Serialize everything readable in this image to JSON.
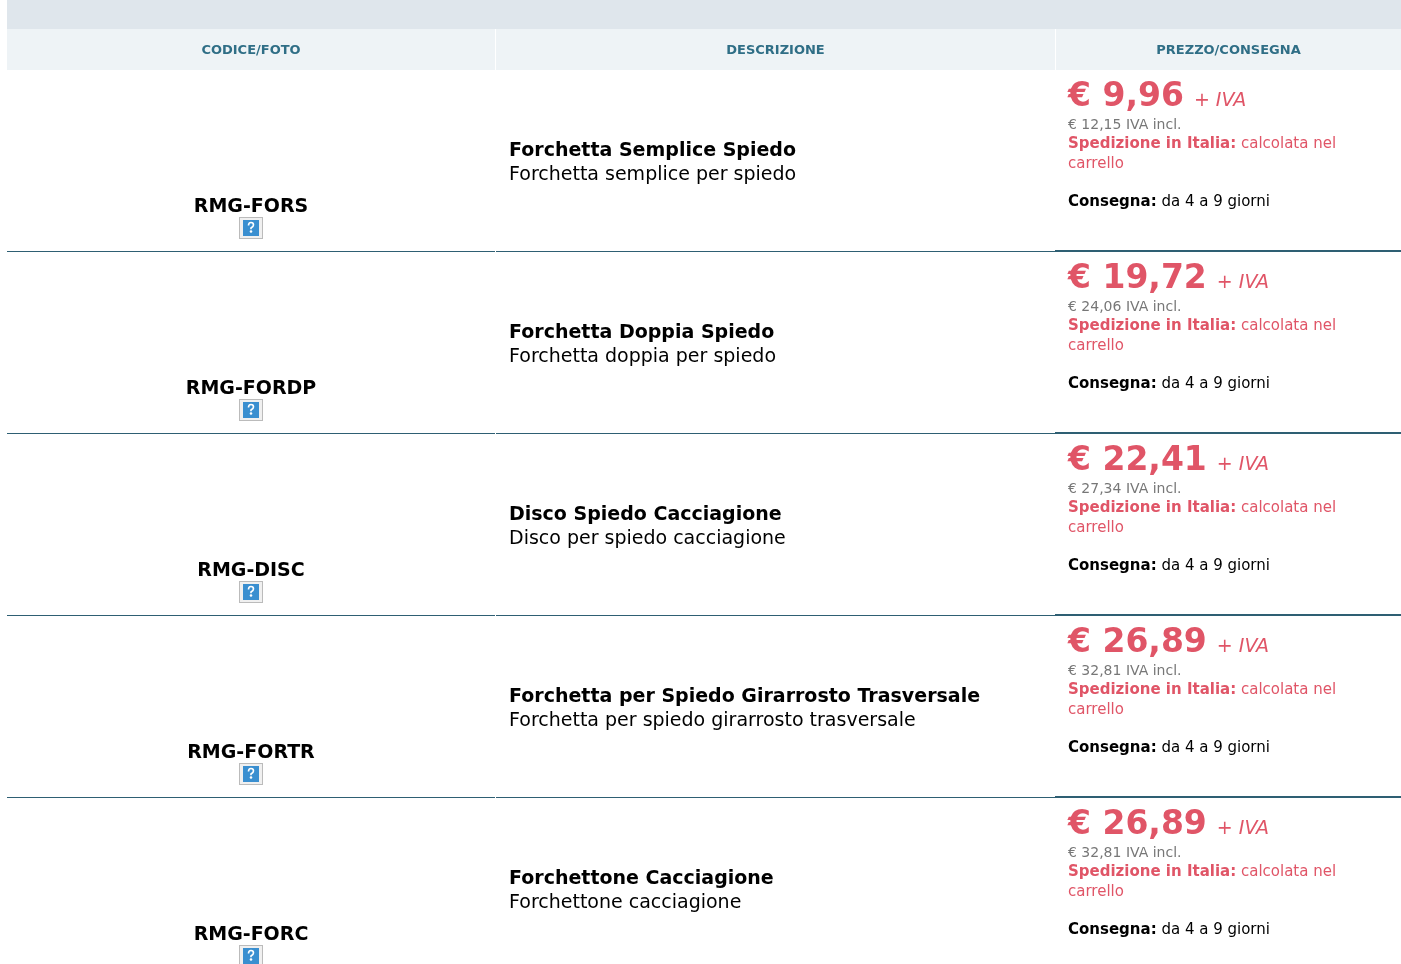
{
  "table": {
    "columns": [
      "CODICE/FOTO",
      "DESCRIZIONE",
      "PREZZO/CONSEGNA"
    ],
    "rows": [
      {
        "code": "RMG-FORS",
        "title": "Forchetta Semplice Spiedo",
        "subtitle": "Forchetta semplice per spiedo",
        "price": "€ 9,96",
        "price_note": "+ IVA",
        "price_incl": "€ 12,15 IVA incl.",
        "shipping_label": "Spedizione in Italia:",
        "shipping_value": "calcolata nel carrello",
        "delivery_label": "Consegna:",
        "delivery_value": "da 4 a 9 giorni"
      },
      {
        "code": "RMG-FORDP",
        "title": "Forchetta Doppia Spiedo",
        "subtitle": "Forchetta doppia per spiedo",
        "price": "€ 19,72",
        "price_note": "+ IVA",
        "price_incl": "€ 24,06 IVA incl.",
        "shipping_label": "Spedizione in Italia:",
        "shipping_value": "calcolata nel carrello",
        "delivery_label": "Consegna:",
        "delivery_value": "da 4 a 9 giorni"
      },
      {
        "code": "RMG-DISC",
        "title": "Disco Spiedo Cacciagione",
        "subtitle": "Disco per spiedo cacciagione",
        "price": "€ 22,41",
        "price_note": "+ IVA",
        "price_incl": "€ 27,34 IVA incl.",
        "shipping_label": "Spedizione in Italia:",
        "shipping_value": "calcolata nel carrello",
        "delivery_label": "Consegna:",
        "delivery_value": "da 4 a 9 giorni"
      },
      {
        "code": "RMG-FORTR",
        "title": "Forchetta per Spiedo Girarrosto Trasversale",
        "subtitle": "Forchetta per spiedo girarrosto trasversale",
        "price": "€ 26,89",
        "price_note": "+ IVA",
        "price_incl": "€ 32,81 IVA incl.",
        "shipping_label": "Spedizione in Italia:",
        "shipping_value": "calcolata nel carrello",
        "delivery_label": "Consegna:",
        "delivery_value": "da 4 a 9 giorni"
      },
      {
        "code": "RMG-FORC",
        "title": "Forchettone Cacciagione",
        "subtitle": "Forchettone cacciagione",
        "price": "€ 26,89",
        "price_note": "+ IVA",
        "price_incl": "€ 32,81 IVA incl.",
        "shipping_label": "Spedizione in Italia:",
        "shipping_value": "calcolata nel carrello",
        "delivery_label": "Consegna:",
        "delivery_value": "da 4 a 9 giorni"
      }
    ]
  }
}
